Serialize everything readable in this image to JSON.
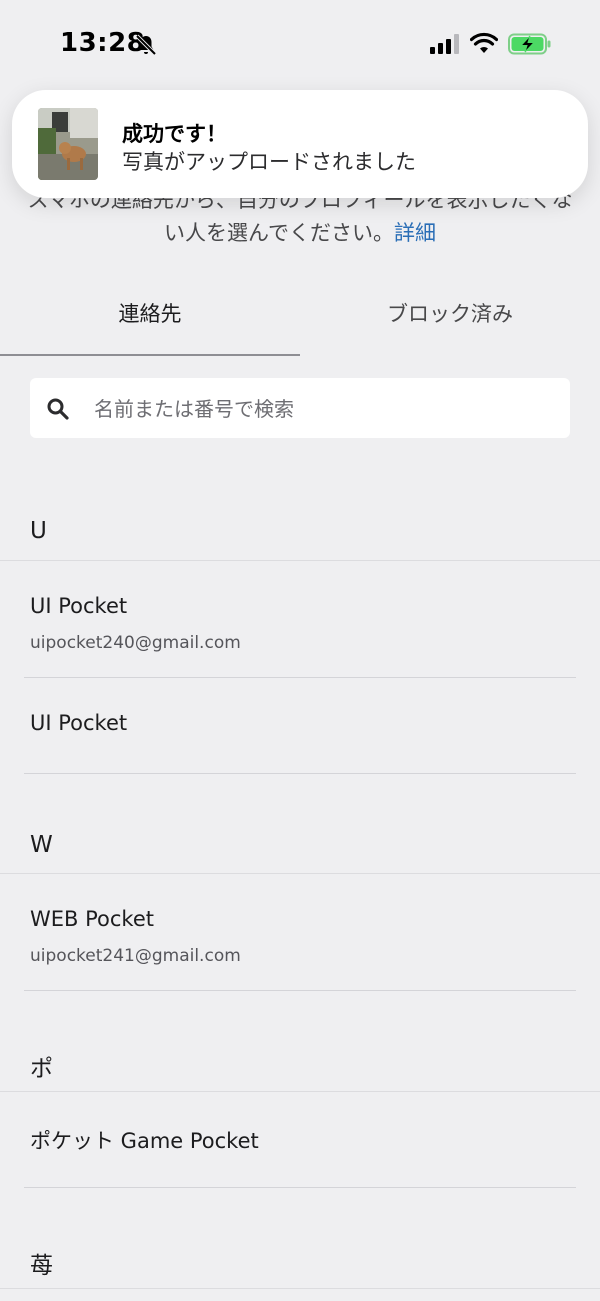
{
  "status_bar": {
    "time": "13:28",
    "icons": [
      "bell-slash-icon",
      "cellular-signal-icon",
      "wifi-icon",
      "battery-charging-icon"
    ],
    "battery_color": "#4cd964"
  },
  "toast": {
    "title": "成功です！",
    "message": "写真がアップロードされました"
  },
  "description": {
    "text": "スマホの連絡先から、自分のプロフィールを表示したくない人を選んでください。",
    "link": "詳細"
  },
  "tabs": [
    {
      "label": "連絡先",
      "active": true
    },
    {
      "label": "ブロック済み",
      "active": false
    }
  ],
  "search": {
    "placeholder": "名前または番号で検索",
    "value": ""
  },
  "sections": [
    {
      "letter": "U",
      "contacts": [
        {
          "name": "UI Pocket",
          "email": "uipocket240@gmail.com"
        },
        {
          "name": "UI Pocket",
          "email": ""
        }
      ]
    },
    {
      "letter": "W",
      "contacts": [
        {
          "name": "WEB Pocket",
          "email": "uipocket241@gmail.com"
        }
      ]
    },
    {
      "letter": "ポ",
      "contacts": [
        {
          "name": "ポケット Game Pocket",
          "email": ""
        }
      ]
    },
    {
      "letter": "苺",
      "contacts": []
    }
  ],
  "colors": {
    "background": "#efeff1",
    "link": "#2a6eb6",
    "toast_background": "#ffffff"
  }
}
